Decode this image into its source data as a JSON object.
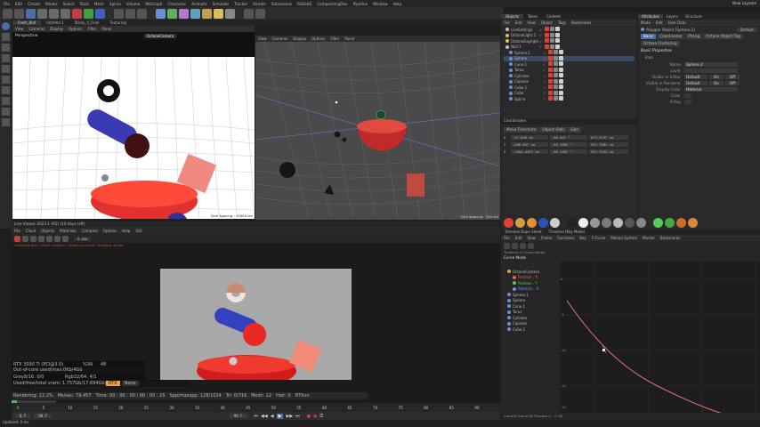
{
  "menubar": {
    "items": [
      "File",
      "Edit",
      "Create",
      "Modes",
      "Select",
      "Tools",
      "Mesh",
      "Spline",
      "Volume",
      "MoGraph",
      "Character",
      "Animate",
      "Simulate",
      "Tracker",
      "Render",
      "Extensions",
      "RSRedS",
      "CompositingDev",
      "Pipeline",
      "Window",
      "Help"
    ],
    "right_label": "New Layouts"
  },
  "scene_tabs": [
    "Fresh_Roll",
    "Untitled 1",
    "Sticky_V_Final",
    "Texturing"
  ],
  "viewport_left": {
    "menu": [
      "View",
      "Cameras",
      "Display",
      "Options",
      "Filter",
      "Panel"
    ],
    "name": "Perspective",
    "camera": "OctaneCamera",
    "grid_spacing": "Grid Spacing : 10000 cm"
  },
  "viewport_right": {
    "menu": [
      "View",
      "Cameras",
      "Display",
      "Options",
      "Filter",
      "Panel"
    ],
    "grid_spacing": "Grid Spacing : 100 cm"
  },
  "objects": {
    "tabs": [
      "Objects",
      "Takes",
      "Content"
    ],
    "menu": [
      "File",
      "Edit",
      "View",
      "Object",
      "Tags",
      "Bookmarks"
    ],
    "items": [
      {
        "name": "LiveSettings",
        "color": "#c0c0c0"
      },
      {
        "name": "OctaneLight.1",
        "color": "#e0c060"
      },
      {
        "name": "OctaneDaylight",
        "color": "#e0c060"
      },
      {
        "name": "Null.1",
        "color": "#c0c0c0"
      },
      {
        "name": "Sphere.1",
        "color": "#6b8fd4"
      },
      {
        "name": "Sphere",
        "color": "#6b8fd4"
      },
      {
        "name": "Cone.1",
        "color": "#6b8fd4"
      },
      {
        "name": "Torus",
        "color": "#6b8fd4"
      },
      {
        "name": "Cylinder",
        "color": "#6b8fd4"
      },
      {
        "name": "Capsule",
        "color": "#6b8fd4"
      },
      {
        "name": "Cube.1",
        "color": "#6b8fd4"
      },
      {
        "name": "Cube",
        "color": "#6b8fd4"
      },
      {
        "name": "Spline",
        "color": "#6b8fd4"
      }
    ]
  },
  "coordinates": {
    "title": "Coordinates",
    "rows": [
      {
        "axis": "X",
        "pos": "-37.696 cm",
        "size": "-98.967 °",
        "rot": "673.3797 cm"
      },
      {
        "axis": "Y",
        "pos": "-496.857 cm",
        "size": "-93.1083 °",
        "rot": "591.7681 cm"
      },
      {
        "axis": "Z",
        "pos": "-1504.4493 cm",
        "size": "-90.1467 °",
        "rot": "591.7693 cm"
      }
    ],
    "buttons": [
      "Move Transform",
      "Object (Rel)",
      "Size"
    ]
  },
  "attributes": {
    "tabs": [
      "Attributes",
      "Layers",
      "Structure"
    ],
    "menu": [
      "Mode",
      "Edit",
      "User Data"
    ],
    "object_title": "Polygon Object [Sphere.2]",
    "preset": "Default",
    "subtabs": [
      "Basic",
      "Coordinates",
      "Phong",
      "Octane Object Tag"
    ],
    "active_subtab": "Basic",
    "subsection": "Octane Clustering",
    "section_title": "Basic Properties",
    "section_sub": "Icon",
    "fields": [
      {
        "k": "Name",
        "v": "Sphere.2"
      },
      {
        "k": "Layer",
        "v": ""
      },
      {
        "k": "Visible in Editor",
        "v": "Default"
      },
      {
        "k": "Visible in Renderer",
        "v": "Default"
      },
      {
        "k": "Display Color",
        "v": "Material"
      },
      {
        "k": "Color",
        "v": ""
      },
      {
        "k": "X-Ray",
        "v": ""
      }
    ],
    "toggle_labels": [
      "On",
      "Off"
    ]
  },
  "live_viewer": {
    "title": "Live Viewer 2023.1 (R2) (10 days left)",
    "menu": [
      "File",
      "Cloud",
      "Objects",
      "Materials",
      "Compare",
      "Options",
      "Help",
      "GUI"
    ],
    "status_line": "Checking files / Mesh creation / Updating scene / Building render",
    "stats": {
      "gpu": "RTX 3090 Ti (PCI@3.0)",
      "gpu_pct": "%99",
      "gpu_temp": "48",
      "ooc": "Out-of-core used/max:0Kb/4Gb",
      "grey": "Grey8/16: 0/0",
      "rgb": "Rgb32/64: 4/1",
      "vram": "Used/free/total vram: 1.757Gb/17.694Gb/23",
      "rtx": "RTX",
      "none": "None"
    },
    "render_line": {
      "rendering": "Rendering: 12.2%",
      "ms": "Ms/sec: 79.457",
      "time": "Time: 00 : 00 : 00 / 00 : 00 : 25",
      "spp": "Spp/maxspp: 128/1024",
      "tri": "Tri: 0/716",
      "mesh": "Mesh: 12",
      "hair": "Hair: 0",
      "rtx": "RTXon"
    },
    "zoom": "0.000"
  },
  "timeline": {
    "ticks": [
      "0",
      "5",
      "10",
      "15",
      "20",
      "25",
      "30",
      "35",
      "40",
      "45",
      "50",
      "55",
      "60",
      "65",
      "70",
      "75",
      "80",
      "85",
      "90"
    ],
    "start": "0 F",
    "end": "90 F",
    "current": "90 F"
  },
  "fcurve": {
    "tabs": [
      "Timeline Dope Sheet",
      "Timeline (Key Mode)"
    ],
    "title": "Timeline (F-Curve Mode)",
    "menu": [
      "File",
      "Edit",
      "View",
      "Frame",
      "Functions",
      "Key",
      "F-Curve",
      "Motion System",
      "Marker",
      "Bookmarks"
    ],
    "root": "Curve Mode",
    "tracks": [
      {
        "name": "OctaneCamera",
        "color": "#e8a040"
      },
      {
        "name": "Position . X",
        "color": "#e06060"
      },
      {
        "name": "Position . Y",
        "color": "#60c060"
      },
      {
        "name": "Rotation . H",
        "color": "#7090e0"
      },
      {
        "name": "Sphere.1",
        "color": "#6b8fd4"
      },
      {
        "name": "Sphere",
        "color": "#6b8fd4"
      },
      {
        "name": "Cone.1",
        "color": "#6b8fd4"
      },
      {
        "name": "Torus",
        "color": "#6b8fd4"
      },
      {
        "name": "Cylinder",
        "color": "#6b8fd4"
      },
      {
        "name": "Capsule",
        "color": "#6b8fd4"
      },
      {
        "name": "Cube.1",
        "color": "#6b8fd4"
      }
    ],
    "y_ticks": [
      "0",
      "-5",
      "-10",
      "-15",
      "-20"
    ],
    "footer": "Current Frame  90  Preview  0 --> 90"
  },
  "status_bar": "Updated: 0 ms",
  "colors": {
    "accent": "#4a6fa5",
    "fcurve": "#e57373",
    "highlight": "#e8a040"
  }
}
